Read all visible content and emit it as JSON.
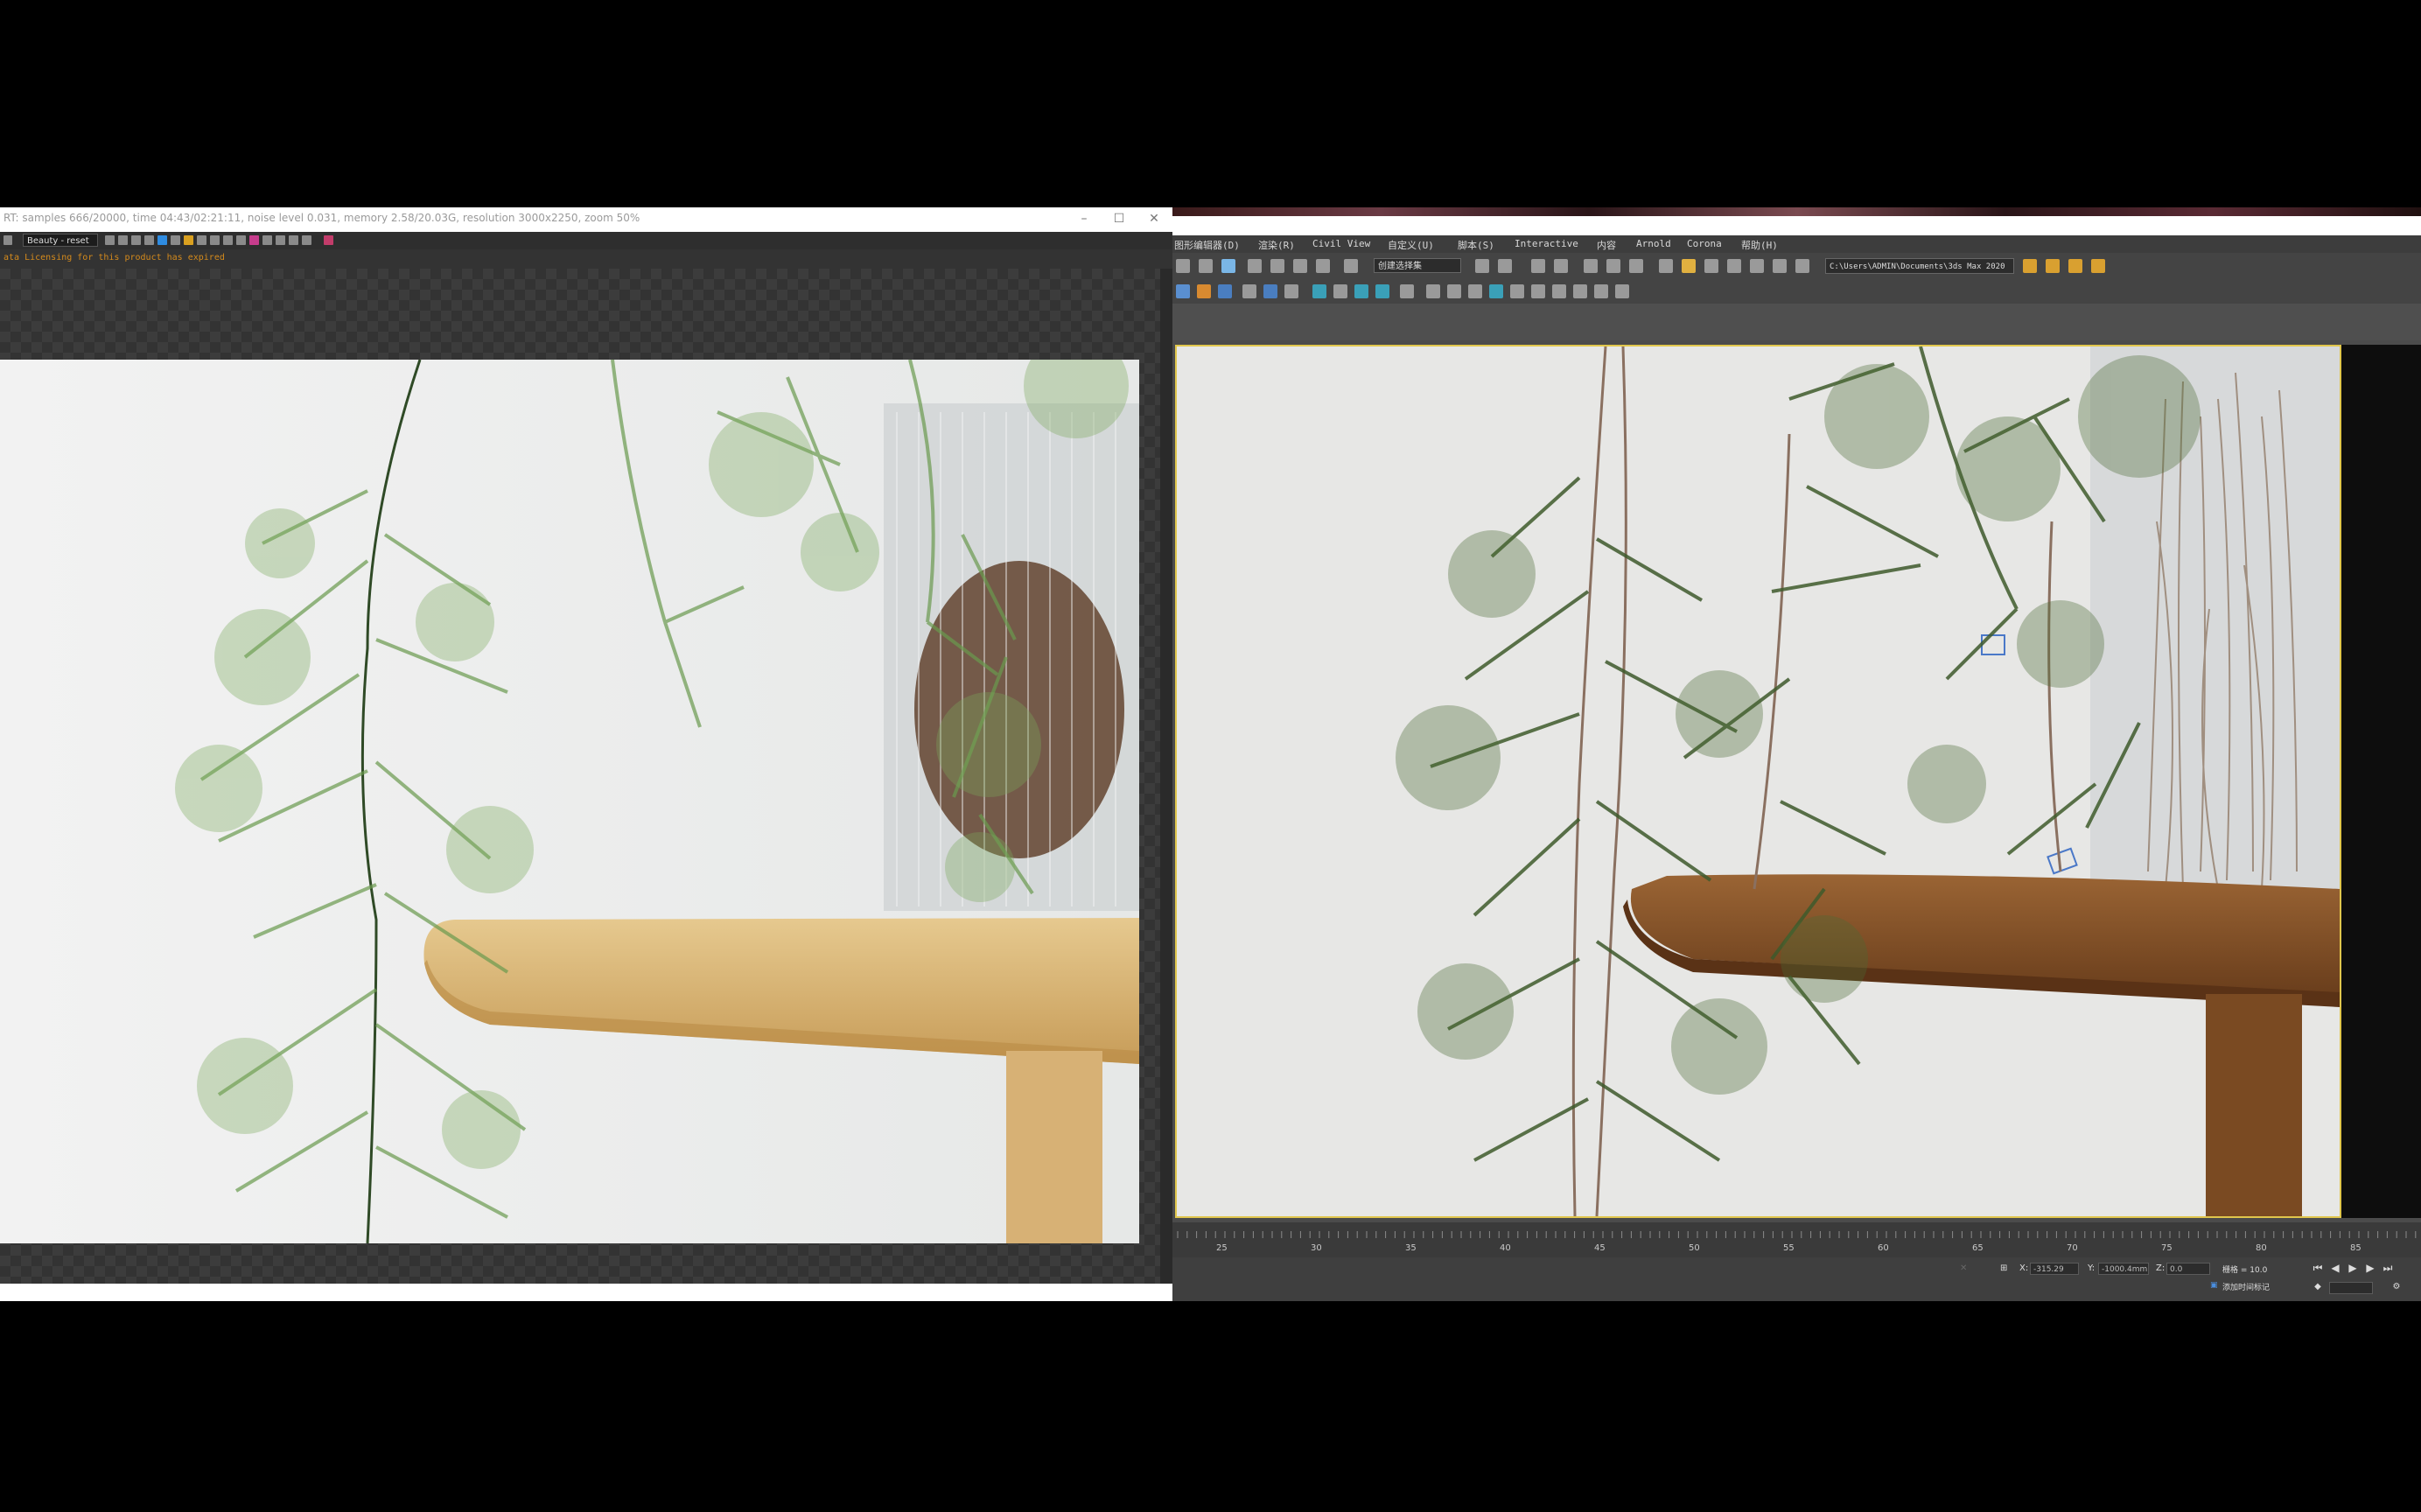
{
  "vfb": {
    "title": "RT: samples 666/20000,  time 04:43/02:21:11,  noise level 0.031,  memory 2.58/20.03G,  resolution 3000x2250,  zoom 50%",
    "layer_select": "Beauty - reset",
    "log_message": "ata  Licensing for this product has expired"
  },
  "max": {
    "menu": [
      "图形编辑器(D)",
      "渲染(R)",
      "Civil View",
      "自定义(U)",
      "脚本(S)",
      "Interactive",
      "内容",
      "Arnold",
      "Corona",
      "帮助(H)"
    ],
    "selection_set": "创建选择集",
    "project_path": "C:\\Users\\ADMIN\\Documents\\3ds Max 2020",
    "timeline_ticks": [
      "25",
      "30",
      "35",
      "40",
      "45",
      "50",
      "55",
      "60",
      "65",
      "70",
      "75",
      "80",
      "85"
    ],
    "status": {
      "x_label": "X:",
      "x_value": "-315.29",
      "y_label": "Y:",
      "y_value": "-1000.4mm",
      "z_label": "Z:",
      "z_value": "0.0",
      "grid_label": "栅格 = 10.0",
      "add_time_tag": "添加时间标记"
    }
  },
  "colors": {
    "viewport_border": "#e0c64c",
    "log_text": "#d48a1c"
  }
}
